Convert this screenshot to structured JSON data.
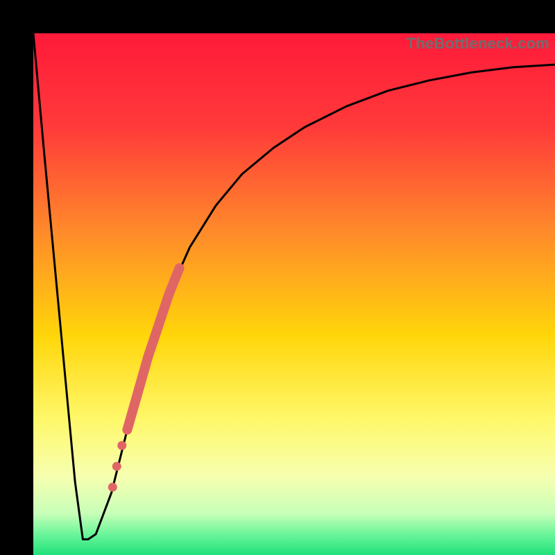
{
  "watermark": {
    "text": "TheBottleneck.com"
  },
  "colors": {
    "frame": "#000000",
    "curve": "#000000",
    "dot_fill": "#e06666",
    "thick_segment": "#e06666",
    "gradient_stops": [
      {
        "pct": 0,
        "color": "#ff1a3a"
      },
      {
        "pct": 18,
        "color": "#ff3a3a"
      },
      {
        "pct": 38,
        "color": "#ff8a2a"
      },
      {
        "pct": 58,
        "color": "#ffd60a"
      },
      {
        "pct": 74,
        "color": "#fff86a"
      },
      {
        "pct": 85,
        "color": "#f6ffb0"
      },
      {
        "pct": 92,
        "color": "#c8ffb8"
      },
      {
        "pct": 96,
        "color": "#6cf59a"
      },
      {
        "pct": 100,
        "color": "#1fe17a"
      }
    ]
  },
  "chart_data": {
    "type": "line",
    "title": "",
    "xlabel": "",
    "ylabel": "",
    "xlim": [
      0,
      100
    ],
    "ylim": [
      0,
      100
    ],
    "series": [
      {
        "name": "bottleneck-curve",
        "x": [
          0,
          2,
          5,
          8,
          9.5,
          10.5,
          12,
          15,
          18,
          22,
          26,
          30,
          35,
          40,
          46,
          52,
          60,
          68,
          76,
          84,
          92,
          100
        ],
        "y": [
          100,
          78,
          46,
          14,
          3,
          3,
          4,
          12,
          24,
          38,
          50,
          59,
          67,
          73,
          78,
          82,
          86,
          89,
          91,
          92.5,
          93.5,
          94
        ]
      }
    ],
    "highlight_segment": {
      "name": "thick-salmon-segment",
      "x": [
        18,
        20,
        22,
        24,
        26,
        28
      ],
      "y": [
        24,
        31,
        38,
        44,
        50,
        55
      ]
    },
    "dots": {
      "name": "salmon-dots",
      "points": [
        {
          "x": 15.2,
          "y": 13
        },
        {
          "x": 16.0,
          "y": 17
        },
        {
          "x": 17.0,
          "y": 21
        }
      ]
    }
  }
}
